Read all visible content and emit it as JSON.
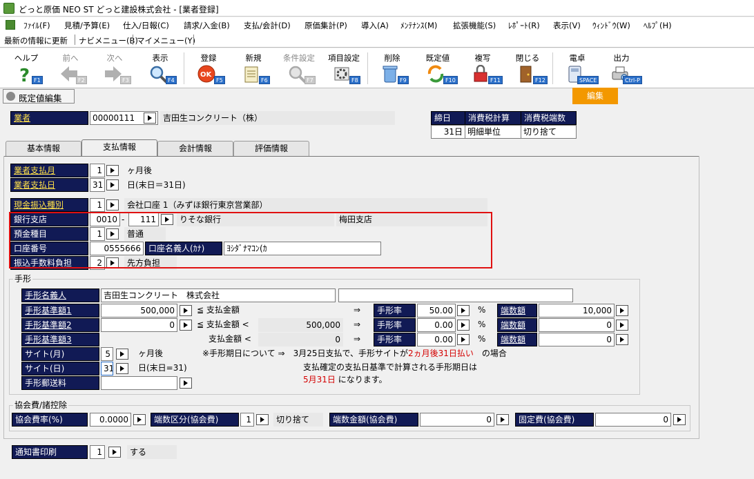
{
  "window": {
    "title": "どっと原価 NEO ST どっと建設株式会社 - [業者登録]"
  },
  "menu": [
    "ﾌｧｲﾙ(F)",
    "見積/予算(E)",
    "仕入/日報(C)",
    "請求/入金(B)",
    "支払/会計(D)",
    "原価集計(P)",
    "導入(A)",
    "ﾒﾝﾃﾅﾝｽ(M)",
    "拡張機能(S)",
    "ﾚﾎﾟｰﾄ(R)",
    "表示(V)",
    "ｳｨﾝﾄﾞｳ(W)",
    "ﾍﾙﾌﾟ(H)"
  ],
  "quick": [
    "最新の情報に更新",
    "ナビメニュー(B)",
    "マイメニュー(Y)"
  ],
  "toolbar": [
    {
      "label": "ヘルプ",
      "key": "F1",
      "icon": "help-icon",
      "enabled": true
    },
    {
      "label": "前へ",
      "key": "F2",
      "icon": "prev-arrow-icon",
      "enabled": false
    },
    {
      "label": "次へ",
      "key": "F3",
      "icon": "next-arrow-icon",
      "enabled": false
    },
    {
      "label": "表示",
      "key": "F4",
      "icon": "magnifier-icon",
      "enabled": true
    },
    {
      "label": "登録",
      "key": "F5",
      "icon": "ok-icon",
      "enabled": true
    },
    {
      "label": "新規",
      "key": "F6",
      "icon": "new-document-icon",
      "enabled": true
    },
    {
      "label": "条件設定",
      "key": "F7",
      "icon": "filter-icon",
      "enabled": false
    },
    {
      "label": "項目設定",
      "key": "F8",
      "icon": "settings-icon",
      "enabled": true
    },
    {
      "label": "削除",
      "key": "F9",
      "icon": "trash-icon",
      "enabled": true
    },
    {
      "label": "既定値",
      "key": "F10",
      "icon": "refresh-icon",
      "enabled": true
    },
    {
      "label": "複写",
      "key": "F11",
      "icon": "copy-lock-icon",
      "enabled": true
    },
    {
      "label": "閉じる",
      "key": "F12",
      "icon": "door-icon",
      "enabled": true
    },
    {
      "label": "電卓",
      "key": "SPACE",
      "icon": "calculator-icon",
      "enabled": true
    },
    {
      "label": "出力",
      "key": "Ctrl-P",
      "icon": "print-icon",
      "enabled": true
    }
  ],
  "default_edit_label": "既定値編集",
  "edit_label": "編集",
  "vendor": {
    "label": "業者",
    "code": "00000111",
    "name": "吉田生コンクリート（株）"
  },
  "closing_table": {
    "headers": [
      "締日",
      "消費税計算",
      "消費税端数"
    ],
    "values": [
      "31日",
      "明細単位",
      "切り捨て"
    ]
  },
  "tabs": [
    "基本情報",
    "支払情報",
    "会計情報",
    "評価情報"
  ],
  "payment": {
    "month_label": "業者支払月",
    "month_value": "1",
    "month_suffix": "ヶ月後",
    "day_label": "業者支払日",
    "day_value": "31",
    "day_desc": "日(末日＝31日)",
    "transfer_label": "現金振込種別",
    "transfer_value": "1",
    "transfer_desc": "会社口座 1（みずほ銀行東京営業部）",
    "bank_label": "銀行支店",
    "bank_code": "0010",
    "bank_sep": "-",
    "branch_code": "111",
    "bank_name": "りそな銀行",
    "branch_name": "梅田支店",
    "deposit_label": "預金種目",
    "deposit_value": "1",
    "deposit_desc": "普通",
    "account_label": "口座番号",
    "account_value": "0555666",
    "holder_label": "口座名義人(ｶﾅ)",
    "holder_value": "ﾖｼﾀﾞﾅﾏｺﾝ(ｶ",
    "fee_label": "振込手数料負担",
    "fee_value": "2",
    "fee_desc": "先方負担"
  },
  "tegata": {
    "group_label": "手形",
    "name_label": "手形名義人",
    "name_value": "吉田生コンクリート　株式会社",
    "name_value2": "",
    "base1_label": "手形基準額1",
    "base1_value": "500,000",
    "base1_cmp": "≦ 支払金額",
    "base2_label": "手形基準額2",
    "base2_value": "0",
    "base2_cmp": "≦ 支払金額 <",
    "base2_ro": "500,000",
    "base3_label": "手形基準額3",
    "base3_cmp": "支払金額 <",
    "base3_ro": "0",
    "arrow": "⇒",
    "rate_label": "手形率",
    "rate1": "50.00",
    "rate2": "0.00",
    "rate3": "0.00",
    "pct": "%",
    "frac_label": "端数額",
    "frac1": "10,000",
    "frac2": "0",
    "frac3": "0",
    "site_month_label": "サイト(月)",
    "site_month_value": "5",
    "site_month_suffix": "ヶ月後",
    "site_day_label": "サイト(日)",
    "site_day_value": "31",
    "site_day_desc": "日(末日=31)",
    "postage_label": "手形郵送料",
    "postage_value": "",
    "note1_a": "※手形期日について ⇒　3月25日支払で、手形サイトが",
    "note1_red": "2ヵ月後31日払い",
    "note1_b": "　の場合",
    "note2": "支払確定の支払日基準で計算される手形期日は",
    "note3_red": "5月31日",
    "note3_b": " になります。"
  },
  "assoc": {
    "group_label": "協会費/諸控除",
    "rate_label": "協会費率(%)",
    "rate_value": "0.0000",
    "frac_label": "端数区分(協会費)",
    "frac_value": "1",
    "frac_desc": "切り捨て",
    "amt_label": "端数金額(協会費)",
    "amt_value": "0",
    "fixed_label": "固定費(協会費)",
    "fixed_value": "0"
  },
  "notice": {
    "label": "通知書印刷",
    "value": "1",
    "desc": "する"
  },
  "colors": {
    "navy": "#111a55",
    "highlight_red": "#e01010",
    "edit_orange": "#f39800",
    "link_yellow": "#ffe14a"
  }
}
